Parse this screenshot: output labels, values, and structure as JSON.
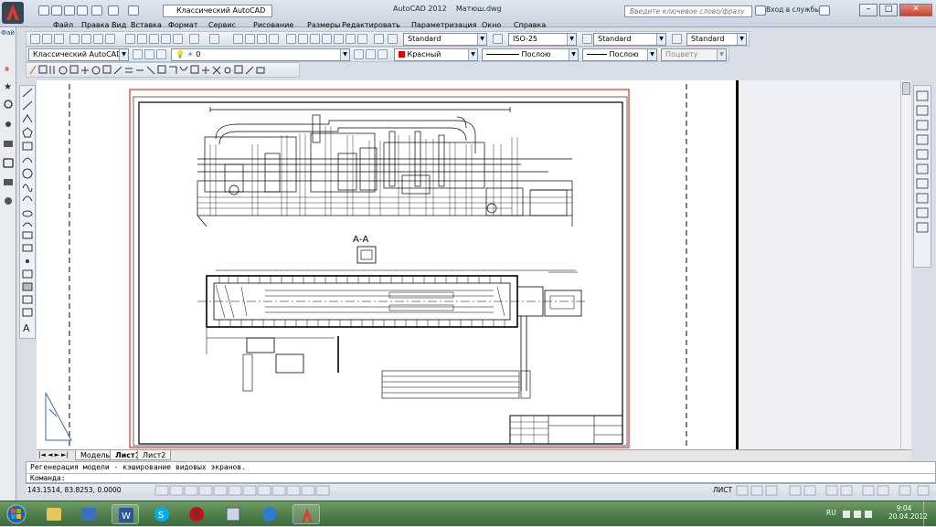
{
  "app": {
    "title": "AutoCAD 2012",
    "filename": "Матюш.dwg",
    "workspace": "Классический AutoCAD",
    "search_placeholder": "Введите ключевое слово/фразу",
    "signin_label": "Вход в службы",
    "left_strip_label": "Фай"
  },
  "menu": [
    "Файл",
    "Правка",
    "Вид",
    "Вставка",
    "Формат",
    "Сервис",
    "Рисование",
    "Размеры",
    "Редактировать",
    "Параметризация",
    "Окно",
    "Справка"
  ],
  "styles": {
    "text_style": "Standard",
    "dim_style": "ISO-25",
    "table_style": "Standard",
    "multileader_style": "Standard"
  },
  "properties": {
    "workspace2": "Классический AutoCAD",
    "layer": "0",
    "color": "Красный",
    "linetype": "Послою",
    "lineweight": "Послою",
    "plotstyle": "Поцвету",
    "color_hex": "#e00000"
  },
  "drawing": {
    "section_label": "А-А"
  },
  "tabs": [
    "Модель",
    "Лист1",
    "Лист2"
  ],
  "active_tab": "Лист1",
  "command": {
    "history": "Регенерация модели - кэширование видовых экранов.",
    "prompt": "Команда:"
  },
  "status": {
    "coords": "143.1514, 83.8253, 0.0000",
    "space": "ЛИСТ"
  },
  "taskbar": {
    "lang": "RU",
    "time": "9:04",
    "date": "20.04.2012"
  }
}
